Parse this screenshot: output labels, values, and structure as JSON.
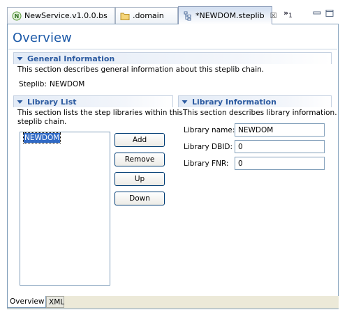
{
  "tabs": [
    {
      "label": "NewService.v1.0.0.bs",
      "icon": "service-icon",
      "active": false
    },
    {
      "label": ".domain",
      "icon": "folder-icon",
      "active": false
    },
    {
      "label": "*NEWDOM.steplib",
      "icon": "steplib-icon",
      "active": true,
      "close": "☒"
    }
  ],
  "overflow": {
    "glyph": "»",
    "count": "1"
  },
  "page": {
    "title": "Overview"
  },
  "general": {
    "header": "General Information",
    "description": "This section describes general information about this steplib chain.",
    "steplib_label": "Steplib:",
    "steplib_value": "NEWDOM"
  },
  "library_list": {
    "header": "Library List",
    "description_line1": "This section lists the step libraries within this",
    "description_line2": "steplib chain.",
    "items": [
      "NEWDOM"
    ],
    "buttons": {
      "add": "Add",
      "remove": "Remove",
      "up": "Up",
      "down": "Down"
    }
  },
  "library_info": {
    "header": "Library Information",
    "description": "This section describes library information.",
    "name_label": "Library name:",
    "name_value": "NEWDOM",
    "dbid_label": "Library DBID:",
    "dbid_value": "0",
    "fnr_label": "Library FNR:",
    "fnr_value": "0"
  },
  "page_tabs": [
    {
      "label": "Overview",
      "active": true
    },
    {
      "label": "XML",
      "active": false
    }
  ],
  "colors": {
    "title": "#1d5aa8",
    "section_header": "#2b5aa0",
    "selection": "#316ac5"
  }
}
